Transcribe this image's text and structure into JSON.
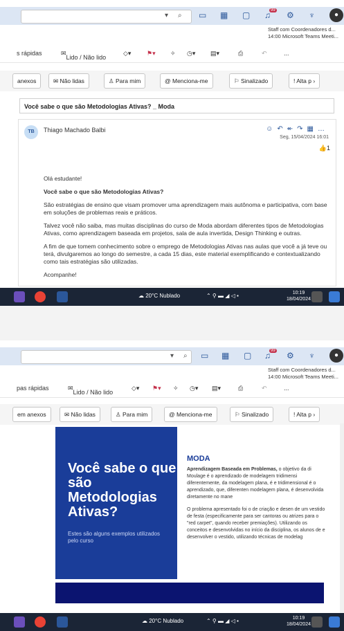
{
  "toolbar": {
    "notif_count": "99",
    "meeting_title": "Staff com Coordenadores d...",
    "meeting_detail": "14:00 Microsoft Teams Meeti...",
    "meeting_detail_2": "14:00 Microsoft Teams Meeti..."
  },
  "ribbon": {
    "quick_steps": "s rápidas",
    "quick_steps_2": "pas rápidas",
    "read_unread": "Lido / Não lido",
    "more": "..."
  },
  "filters": {
    "attachments": "anexos",
    "attachments_2": "em anexos",
    "unread": "Não lidas",
    "to_me": "Para mim",
    "mentions": "Menciona-me",
    "flagged": "Sinalizado",
    "high": "Alta p"
  },
  "email": {
    "subject": "Você sabe o que são Metodologias Ativas? _ Moda",
    "sender_initials": "TB",
    "sender": "Thiago Machado Balbi",
    "date": "Seg, 15/04/2024 16:01",
    "likes": "1",
    "greeting": "Olá estudante!",
    "heading": "Você sabe o que são Metodologias Ativas?",
    "p1": "São estratégias de ensino que visam promover uma aprendizagem mais autônoma e participativa, com base em soluções de problemas reais e práticos.",
    "p2": "Talvez você não saiba, mas muitas disciplinas do curso de Moda abordam diferentes tipos de Metodologias Ativas, como aprendizagem baseada em projetos, sala de aula invertida, Design Thinking e outras.",
    "p3": "A fim de que tomem conhecimento sobre o emprego de Metodologias Ativas nas aulas que você a já teve ou terá, divulgaremos ao longo do semestre, a cada 15 dias, este material exemplificando e contextualizando como tais estratégias são utilizadas.",
    "p4": "Acompanhe!"
  },
  "banner": {
    "title": "Você sabe o que são Metodologias Ativas?",
    "subtitle": "Estes são alguns exemplos utilizados pelo curso",
    "section": "MODA",
    "lead": "Aprendizagem Baseada em Problemas,",
    "text1": " o objetivo da di Moulage é o aprendizado de modelagem tridimensi diferentemente, da modelagem plana, é e tridimensional é o aprendizado, que, diferenten modelagem plana, é desenvolvida diretamente no mane",
    "text2": "O problema apresentado foi o de criação e desen de um vestido de festa (especificamente para ser cantoras ou atrizes para o \"red carpet\", quando receber premiações). Utilizando os conceitos e desenvolvidas no início da disciplina, os alunos de e desenvolver o vestido, utilizando técnicas de modelag"
  },
  "taskbar": {
    "weather": "20°C  Nublado",
    "time": "10:19",
    "date": "18/04/2024"
  }
}
